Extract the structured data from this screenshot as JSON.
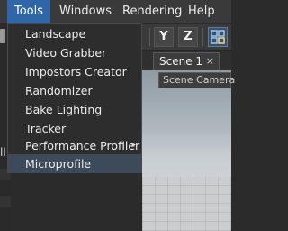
{
  "menubar": {
    "items": [
      "Tools",
      "Windows",
      "Rendering",
      "Help"
    ]
  },
  "tools_menu": {
    "items": [
      {
        "label": "Landscape"
      },
      {
        "label": "Video Grabber"
      },
      {
        "label": "Impostors Creator"
      },
      {
        "label": "Randomizer"
      },
      {
        "label": "Bake Lighting"
      },
      {
        "label": "Tracker"
      },
      {
        "label": "Performance Profiler",
        "submenu": true,
        "arrow": "▸"
      },
      {
        "label": "Microprofile"
      }
    ]
  },
  "toolbar": {
    "y_label": "Y",
    "z_label": "Z",
    "grid_icon": "grid-move-icon"
  },
  "scene_tab": {
    "label": "Scene 1",
    "close": "×"
  },
  "viewport": {
    "camera": "Scene Camera"
  },
  "left_panel": {
    "cut_text": "ll"
  },
  "colors": {
    "menu_active": "#2f66a8",
    "menu_bg": "#2d2d2d",
    "item_hover": "#3c4a5a"
  }
}
